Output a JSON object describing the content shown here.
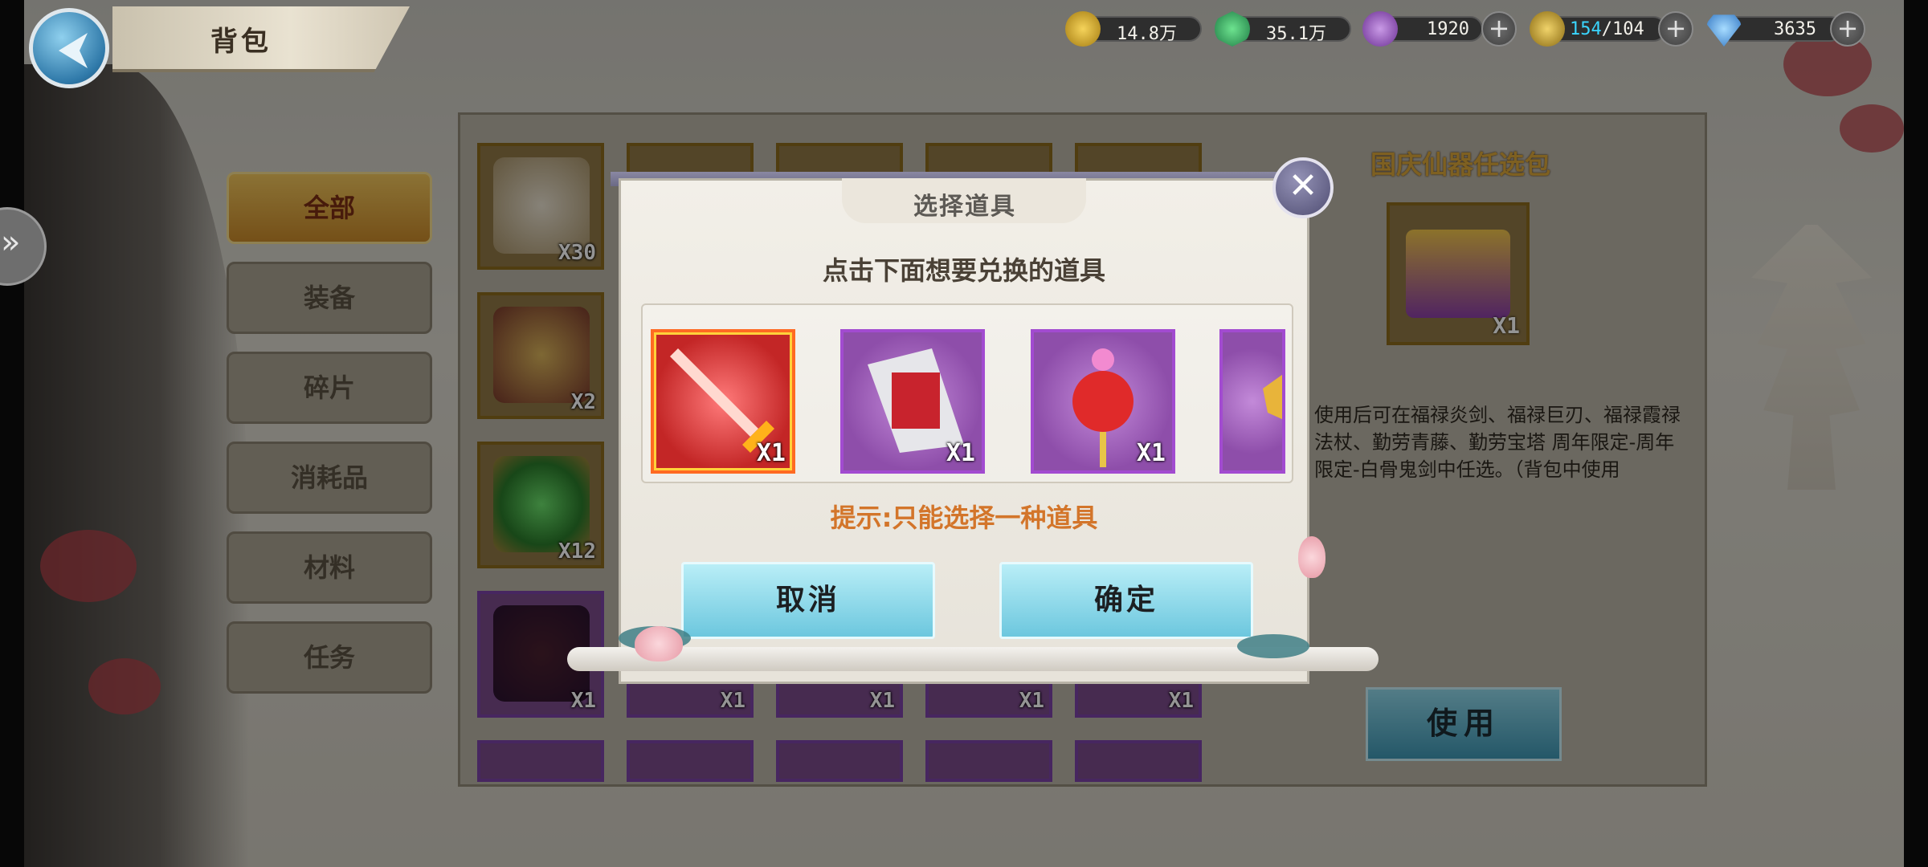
{
  "header": {
    "title": "背包"
  },
  "currencies": [
    {
      "name": "gold",
      "value": "14.8万",
      "color": "#d4a72c"
    },
    {
      "name": "jade",
      "value": "35.1万",
      "color": "#27a35c"
    },
    {
      "name": "spirit",
      "value": "1920",
      "color": "#9a5fc0"
    },
    {
      "name": "stamina",
      "value": "154/104",
      "value_highlight": "154",
      "value_rest": "/104",
      "color": "#c8a23a",
      "highlight_color": "#3ad6ff"
    },
    {
      "name": "diamond",
      "value": "3635",
      "color": "#4aa8e8"
    }
  ],
  "categories": [
    {
      "label": "全部",
      "active": true
    },
    {
      "label": "装备",
      "active": false
    },
    {
      "label": "碎片",
      "active": false
    },
    {
      "label": "消耗品",
      "active": false
    },
    {
      "label": "材料",
      "active": false
    },
    {
      "label": "任务",
      "active": false
    }
  ],
  "grid": {
    "row1": [
      {
        "count": "X30"
      }
    ],
    "row2": [
      {
        "count": "X2"
      }
    ],
    "row3": [
      {
        "count": "X12"
      }
    ],
    "row4": [
      {
        "count": "X1"
      },
      {
        "count": "X1"
      },
      {
        "count": "X1"
      },
      {
        "count": "X1"
      },
      {
        "count": "X1"
      }
    ]
  },
  "detail": {
    "name": "国庆仙器任选包",
    "count": "X1",
    "description": "使用后可在福禄炎剑、福禄巨刃、福禄霞禄法杖、勤劳青藤、勤劳宝塔 周年限定-周年限定-白骨鬼剑中任选。（背包中使用",
    "use_label": "使用"
  },
  "dialog": {
    "title": "选择道具",
    "instruction": "点击下面想要兑换的道具",
    "choices": [
      {
        "name": "flame-sword",
        "count": "X1",
        "selected": true
      },
      {
        "name": "giant-blade",
        "count": "X1",
        "selected": false
      },
      {
        "name": "staff",
        "count": "X1",
        "selected": false
      },
      {
        "name": "partial-item",
        "count": "",
        "selected": false
      }
    ],
    "hint": "提示:只能选择一种道具",
    "cancel_label": "取消",
    "confirm_label": "确定"
  },
  "colors": {
    "accent_orange": "#d3752a",
    "selected_border": "#ff6a22",
    "rarity_purple": "#a24bd0"
  }
}
